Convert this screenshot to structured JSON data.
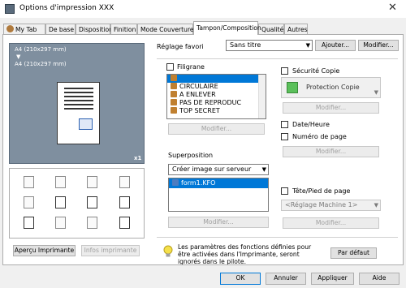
{
  "window": {
    "title": "Options d'impression XXX",
    "close_glyph": "✕"
  },
  "tabs": [
    "My Tab",
    "De base",
    "Disposition",
    "Finition",
    "Mode Couverture",
    "Tampon/Composition",
    "Qualité",
    "Autres"
  ],
  "active_tab": "Tampon/Composition",
  "favorites": {
    "label": "Réglage favori",
    "value": "Sans titre",
    "add": "Ajouter...",
    "modify": "Modifier..."
  },
  "preview": {
    "paper_top": "A4 (210x297 mm)",
    "paper_bottom": "A4 (210x297 mm)",
    "arrow": "▼",
    "copies": "x1"
  },
  "left_buttons": {
    "printer_view": "Aperçu Imprimante",
    "printer_info": "Infos imprimante"
  },
  "watermark": {
    "label": "Filigrane",
    "items": [
      "",
      "CIRCULAIRE",
      "A ENLEVER",
      "PAS DE REPRODUC",
      "TOP SECRET"
    ],
    "modify": "Modifier..."
  },
  "overlay": {
    "label": "Superposition",
    "mode": "Créer image sur serveur",
    "items": [
      "form1.KFO"
    ],
    "modify": "Modifier..."
  },
  "security": {
    "label": "Sécurité Copie",
    "value": "Protection Copie",
    "modify": "Modifier..."
  },
  "date_time": {
    "label": "Date/Heure",
    "modify": "Modifier..."
  },
  "page_number": {
    "label": "Numéro de page"
  },
  "header_footer": {
    "label": "Tête/Pied de page",
    "value": "<Réglage Machine 1>",
    "modify": "Modifier..."
  },
  "note": "Les paramètres des fonctions définies pour être activées dans l'Imprimante, seront ignorés dans le pilote.",
  "default_button": "Par défaut",
  "dialog": {
    "ok": "OK",
    "cancel": "Annuler",
    "apply": "Appliquer",
    "help": "Aide"
  },
  "colors": {
    "accent": "#0078d7",
    "preview_bg": "#7f8f9f"
  }
}
